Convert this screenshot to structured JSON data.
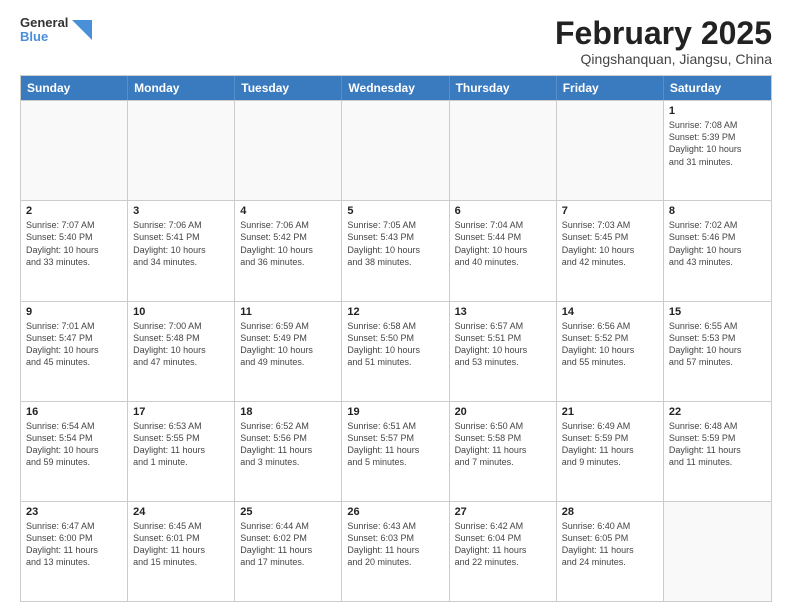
{
  "header": {
    "logo_general": "General",
    "logo_blue": "Blue",
    "month_title": "February 2025",
    "location": "Qingshanquan, Jiangsu, China"
  },
  "weekdays": [
    "Sunday",
    "Monday",
    "Tuesday",
    "Wednesday",
    "Thursday",
    "Friday",
    "Saturday"
  ],
  "rows": [
    [
      {
        "day": "",
        "info": ""
      },
      {
        "day": "",
        "info": ""
      },
      {
        "day": "",
        "info": ""
      },
      {
        "day": "",
        "info": ""
      },
      {
        "day": "",
        "info": ""
      },
      {
        "day": "",
        "info": ""
      },
      {
        "day": "1",
        "info": "Sunrise: 7:08 AM\nSunset: 5:39 PM\nDaylight: 10 hours\nand 31 minutes."
      }
    ],
    [
      {
        "day": "2",
        "info": "Sunrise: 7:07 AM\nSunset: 5:40 PM\nDaylight: 10 hours\nand 33 minutes."
      },
      {
        "day": "3",
        "info": "Sunrise: 7:06 AM\nSunset: 5:41 PM\nDaylight: 10 hours\nand 34 minutes."
      },
      {
        "day": "4",
        "info": "Sunrise: 7:06 AM\nSunset: 5:42 PM\nDaylight: 10 hours\nand 36 minutes."
      },
      {
        "day": "5",
        "info": "Sunrise: 7:05 AM\nSunset: 5:43 PM\nDaylight: 10 hours\nand 38 minutes."
      },
      {
        "day": "6",
        "info": "Sunrise: 7:04 AM\nSunset: 5:44 PM\nDaylight: 10 hours\nand 40 minutes."
      },
      {
        "day": "7",
        "info": "Sunrise: 7:03 AM\nSunset: 5:45 PM\nDaylight: 10 hours\nand 42 minutes."
      },
      {
        "day": "8",
        "info": "Sunrise: 7:02 AM\nSunset: 5:46 PM\nDaylight: 10 hours\nand 43 minutes."
      }
    ],
    [
      {
        "day": "9",
        "info": "Sunrise: 7:01 AM\nSunset: 5:47 PM\nDaylight: 10 hours\nand 45 minutes."
      },
      {
        "day": "10",
        "info": "Sunrise: 7:00 AM\nSunset: 5:48 PM\nDaylight: 10 hours\nand 47 minutes."
      },
      {
        "day": "11",
        "info": "Sunrise: 6:59 AM\nSunset: 5:49 PM\nDaylight: 10 hours\nand 49 minutes."
      },
      {
        "day": "12",
        "info": "Sunrise: 6:58 AM\nSunset: 5:50 PM\nDaylight: 10 hours\nand 51 minutes."
      },
      {
        "day": "13",
        "info": "Sunrise: 6:57 AM\nSunset: 5:51 PM\nDaylight: 10 hours\nand 53 minutes."
      },
      {
        "day": "14",
        "info": "Sunrise: 6:56 AM\nSunset: 5:52 PM\nDaylight: 10 hours\nand 55 minutes."
      },
      {
        "day": "15",
        "info": "Sunrise: 6:55 AM\nSunset: 5:53 PM\nDaylight: 10 hours\nand 57 minutes."
      }
    ],
    [
      {
        "day": "16",
        "info": "Sunrise: 6:54 AM\nSunset: 5:54 PM\nDaylight: 10 hours\nand 59 minutes."
      },
      {
        "day": "17",
        "info": "Sunrise: 6:53 AM\nSunset: 5:55 PM\nDaylight: 11 hours\nand 1 minute."
      },
      {
        "day": "18",
        "info": "Sunrise: 6:52 AM\nSunset: 5:56 PM\nDaylight: 11 hours\nand 3 minutes."
      },
      {
        "day": "19",
        "info": "Sunrise: 6:51 AM\nSunset: 5:57 PM\nDaylight: 11 hours\nand 5 minutes."
      },
      {
        "day": "20",
        "info": "Sunrise: 6:50 AM\nSunset: 5:58 PM\nDaylight: 11 hours\nand 7 minutes."
      },
      {
        "day": "21",
        "info": "Sunrise: 6:49 AM\nSunset: 5:59 PM\nDaylight: 11 hours\nand 9 minutes."
      },
      {
        "day": "22",
        "info": "Sunrise: 6:48 AM\nSunset: 5:59 PM\nDaylight: 11 hours\nand 11 minutes."
      }
    ],
    [
      {
        "day": "23",
        "info": "Sunrise: 6:47 AM\nSunset: 6:00 PM\nDaylight: 11 hours\nand 13 minutes."
      },
      {
        "day": "24",
        "info": "Sunrise: 6:45 AM\nSunset: 6:01 PM\nDaylight: 11 hours\nand 15 minutes."
      },
      {
        "day": "25",
        "info": "Sunrise: 6:44 AM\nSunset: 6:02 PM\nDaylight: 11 hours\nand 17 minutes."
      },
      {
        "day": "26",
        "info": "Sunrise: 6:43 AM\nSunset: 6:03 PM\nDaylight: 11 hours\nand 20 minutes."
      },
      {
        "day": "27",
        "info": "Sunrise: 6:42 AM\nSunset: 6:04 PM\nDaylight: 11 hours\nand 22 minutes."
      },
      {
        "day": "28",
        "info": "Sunrise: 6:40 AM\nSunset: 6:05 PM\nDaylight: 11 hours\nand 24 minutes."
      },
      {
        "day": "",
        "info": ""
      }
    ]
  ]
}
